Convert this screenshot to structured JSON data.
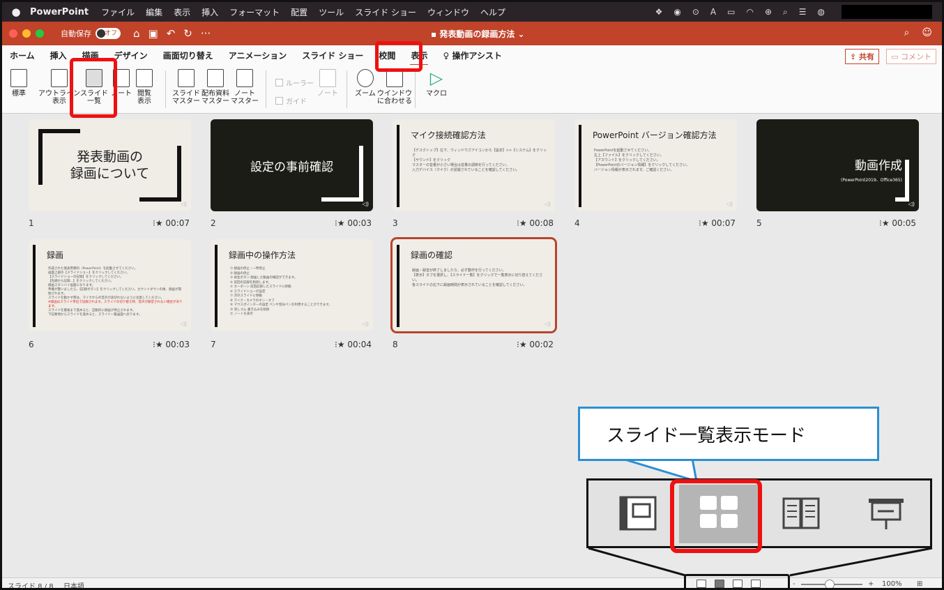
{
  "menubar": {
    "app": "PowerPoint",
    "items": [
      "ファイル",
      "編集",
      "表示",
      "挿入",
      "フォーマット",
      "配置",
      "ツール",
      "スライド ショー",
      "ウィンドウ",
      "ヘルプ"
    ],
    "status_letter": "A"
  },
  "titlebar": {
    "autosave_label": "自動保存",
    "autosave_state": "オフ",
    "more": "···",
    "document_title": "発表動画の録画方法"
  },
  "ribbon_tabs": [
    "ホーム",
    "挿入",
    "描画",
    "デザイン",
    "画面切り替え",
    "アニメーション",
    "スライド ショー",
    "校閲",
    "表示",
    "操作アシスト"
  ],
  "active_tab": "表示",
  "share_label": "共有",
  "comment_label": "コメント",
  "ribbon_buttons": {
    "normal": "標準",
    "outline": [
      "アウトライン",
      "表示"
    ],
    "sorter": [
      "スライド",
      "一覧"
    ],
    "notes": "ノート",
    "reading": [
      "閲覧",
      "表示"
    ],
    "slide_master": [
      "スライド",
      "マスター"
    ],
    "handout_master": [
      "配布資料",
      "マスター"
    ],
    "notes_master": [
      "ノート",
      "マスター"
    ],
    "ruler": "ルーラー",
    "guide": "ガイド",
    "notes_pane": "ノート",
    "zoom": "ズーム",
    "fit": [
      "ウインドウ",
      "に合わせる"
    ],
    "macro": "マクロ"
  },
  "slides": [
    {
      "num": "1",
      "time": "00:07",
      "title_lines": [
        "発表動画の",
        "録画について"
      ]
    },
    {
      "num": "2",
      "time": "00:03",
      "title": "設定の事前確認"
    },
    {
      "num": "3",
      "time": "00:08",
      "title": "マイク接続確認方法",
      "body": [
        "【デスクトップ】左下、ウィンドウズアイコンから【設定】>>【システム】をクリック",
        "【サウンド】をクリック",
        "マスターの音量が小さい場合は音量の調節を行ってください。",
        "入力デバイス（マイク）が認識されていることを確認してください。"
      ]
    },
    {
      "num": "4",
      "time": "00:07",
      "title": "PowerPoint バージョン確認方法",
      "body": [
        "PowerPointを起動させてください。",
        "左上【ファイル】をクリックしてください。",
        "【アカウント】をクリックしてください。",
        "【PowerPointのバージョン情報】をクリックしてください。",
        "バージョン情報が表示されます。ご確認ください。"
      ]
    },
    {
      "num": "5",
      "time": "00:05",
      "title": "動画作成",
      "subtitle": "(PowerPoint2019、Office365)"
    },
    {
      "num": "6",
      "time": "00:03",
      "title": "録画",
      "body": [
        "作成された発表用資料（PowerPoint）を起動させてください。",
        "画面上部の【スライドショー】をクリックしてください。",
        "【スライドショーの記録】をクリックしてください。",
        "【先頭から記録...】をクリックしてください。",
        "録画スタンバイ画面になります。",
        "準備が整いましたら、【記録ボタン】をクリックしてください。カウントダウンの後、録画が開始されます。",
        "スライドを動かす際は、マイクからの音声が途切れないように注意してください。"
      ],
      "warning": "※録画はスライド単位で記録されます。スライドの切り替え時、音声が録音されない場合があります。",
      "tail": [
        "スライドを最後まで進めると、自動的に録画が停止されます。",
        "下記要領からスライドを進めると、スライド一覧画面へ戻ります。"
      ]
    },
    {
      "num": "7",
      "time": "00:04",
      "title": "録画中の操作方法",
      "body": [
        "① 録画の停止・一時停止",
        "② 録画の停止",
        "③ 再生ボタン 録画した動画の確認ができます。",
        "④ 前回の記録を削除します。",
        "⑤ カーボーン 前回記録したスライドに移動",
        "⑥ スライドショーの設定",
        "⑦ 次のスライドに移動",
        "⑧ マイク・カメラのオン・オフ",
        "⑨ マウスポインターの設定 ペンや蛍光ペンを利用することができます。",
        "⑩ 消しゴム 書き込みを削除",
        "⑪ ノートを表示"
      ]
    },
    {
      "num": "8",
      "time": "00:02",
      "title": "録画の確認",
      "body": [
        "録画・録音が終了しましたら、必ず動作を行ってください。",
        "【表示】タブを選択し、【スライド一覧】をクリックで一覧表示に切り替えてください。",
        "各スライドの右下に録画時間が表示されていることを確認してください。"
      ]
    }
  ],
  "selected_slide": "8",
  "callout_text": "スライド一覧表示モード",
  "statusbar": {
    "slide_info": "スライド 8 / 8",
    "language": "日本語",
    "zoom": "100%",
    "minus": "-",
    "plus": "+"
  },
  "colors": {
    "accent": "#c0432a",
    "annotation_red": "#ee1111",
    "callout_border": "#2a8fd0"
  }
}
